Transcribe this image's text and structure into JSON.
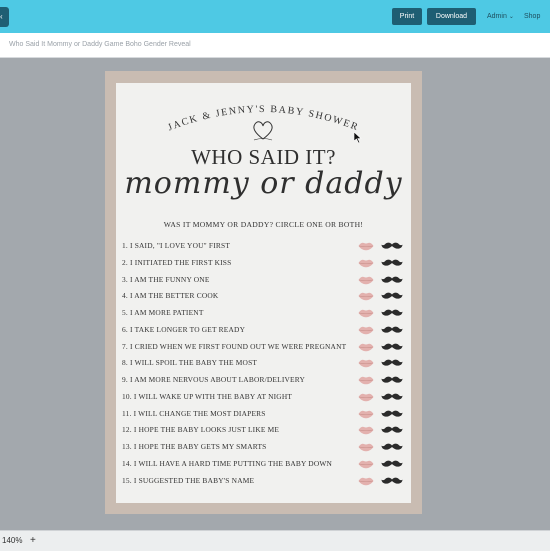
{
  "toolbar": {
    "print_label": "Print",
    "download_label": "Download",
    "admin_label": "Admin",
    "shop_label": "Shop"
  },
  "document": {
    "title": "Who Said It Mommy or Daddy Game Boho Gender Reveal"
  },
  "status": {
    "zoom": "140%",
    "zoom_in_label": "+"
  },
  "card": {
    "shower_line": "JACK & JENNY'S BABY SHOWER",
    "title": "WHO SAID IT?",
    "script": "mommy or daddy",
    "instructions": "WAS IT MOMMY OR DADDY?  CIRCLE ONE OR BOTH!",
    "questions": [
      "1. I SAID, \"I LOVE YOU\" FIRST",
      "2. I INITIATED THE FIRST KISS",
      "3. I AM THE FUNNY ONE",
      "4. I AM THE BETTER COOK",
      "5. I AM MORE PATIENT",
      "6. I TAKE LONGER TO GET READY",
      "7. I CRIED WHEN WE FIRST FOUND OUT WE WERE PREGNANT",
      "8. I WILL SPOIL THE BABY THE MOST",
      "9. I AM MORE NERVOUS ABOUT LABOR/DELIVERY",
      "10. I WILL WAKE UP WITH THE BABY AT NIGHT",
      "11. I WILL CHANGE THE MOST DIAPERS",
      "12. I HOPE THE BABY LOOKS JUST LIKE ME",
      "13. I HOPE THE BABY GETS MY SMARTS",
      "14. I WILL HAVE A HARD TIME PUTTING THE BABY DOWN",
      "15. I SUGGESTED THE BABY'S NAME"
    ]
  },
  "colors": {
    "header_bar": "#4ec9e4",
    "button": "#1e5e73",
    "frame": "#c9bcb2",
    "lips": "#e3b1ae",
    "mustache": "#2b2b2b"
  },
  "icons": {
    "lips": "lips-icon",
    "mustache": "mustache-icon",
    "heart": "heart-icon",
    "cursor": "cursor-icon"
  }
}
